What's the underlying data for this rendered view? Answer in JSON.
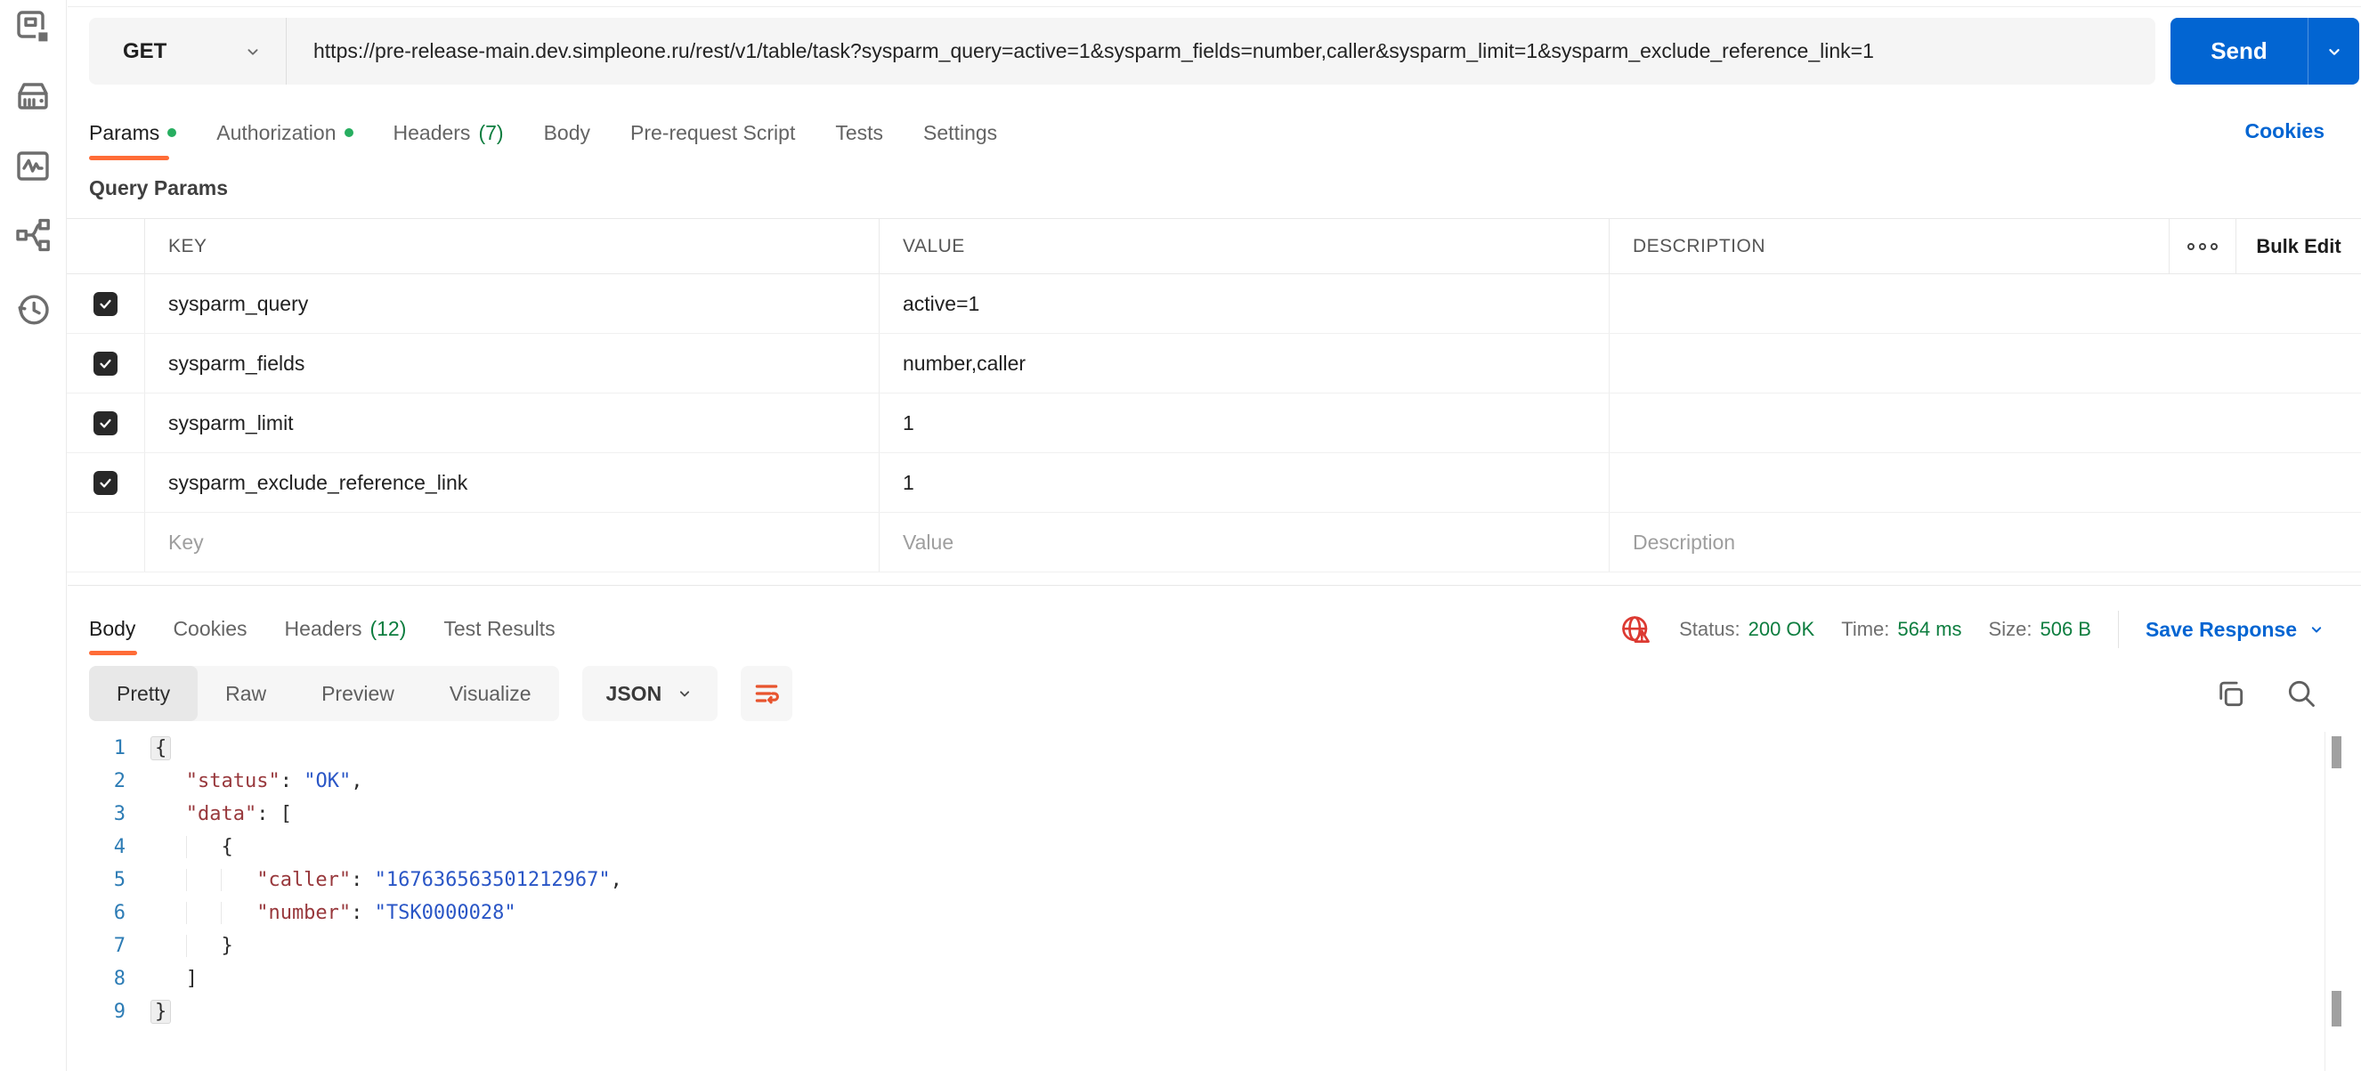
{
  "sidebar": {
    "icons": [
      "collections",
      "environments",
      "monitors",
      "flows",
      "history"
    ]
  },
  "request": {
    "method": "GET",
    "url": "https://pre-release-main.dev.simpleone.ru/rest/v1/table/task?sysparm_query=active=1&sysparm_fields=number,caller&sysparm_limit=1&sysparm_exclude_reference_link=1",
    "send_label": "Send",
    "cookies_link": "Cookies",
    "tabs": [
      {
        "label": "Params",
        "modified": true,
        "active": true
      },
      {
        "label": "Authorization",
        "modified": true
      },
      {
        "label": "Headers",
        "count": "(7)"
      },
      {
        "label": "Body"
      },
      {
        "label": "Pre-request Script"
      },
      {
        "label": "Tests"
      },
      {
        "label": "Settings"
      }
    ]
  },
  "query_params": {
    "title": "Query Params",
    "columns": {
      "key": "KEY",
      "value": "VALUE",
      "description": "DESCRIPTION"
    },
    "bulk_edit_label": "Bulk Edit",
    "more_options_icon": "three-dots",
    "rows": [
      {
        "checked": true,
        "key": "sysparm_query",
        "value": "active=1",
        "description": ""
      },
      {
        "checked": true,
        "key": "sysparm_fields",
        "value": "number,caller",
        "description": ""
      },
      {
        "checked": true,
        "key": "sysparm_limit",
        "value": "1",
        "description": ""
      },
      {
        "checked": true,
        "key": "sysparm_exclude_reference_link",
        "value": "1",
        "description": ""
      }
    ],
    "placeholder_row": {
      "key": "Key",
      "value": "Value",
      "description": "Description"
    }
  },
  "response": {
    "tabs": [
      {
        "label": "Body",
        "active": true
      },
      {
        "label": "Cookies"
      },
      {
        "label": "Headers",
        "count": "(12)"
      },
      {
        "label": "Test Results"
      }
    ],
    "meta": {
      "network_icon": "globe-warning",
      "status_label": "Status:",
      "status_value": "200 OK",
      "time_label": "Time:",
      "time_value": "564 ms",
      "size_label": "Size:",
      "size_value": "506 B",
      "save_label": "Save Response"
    },
    "viewer": {
      "tabs": [
        {
          "label": "Pretty",
          "active": true
        },
        {
          "label": "Raw"
        },
        {
          "label": "Preview"
        },
        {
          "label": "Visualize"
        }
      ],
      "language": "JSON",
      "icons": [
        "wrap-text",
        "copy",
        "search"
      ]
    },
    "code": {
      "lines": [
        {
          "n": "1",
          "tokens": [
            {
              "t": "fold",
              "v": "{"
            }
          ]
        },
        {
          "n": "2",
          "tokens": [
            {
              "t": "key",
              "v": "\"status\""
            },
            {
              "t": "p",
              "v": ": "
            },
            {
              "t": "str",
              "v": "\"OK\""
            },
            {
              "t": "p",
              "v": ","
            }
          ]
        },
        {
          "n": "3",
          "tokens": [
            {
              "t": "key",
              "v": "\"data\""
            },
            {
              "t": "p",
              "v": ": ["
            }
          ]
        },
        {
          "n": "4",
          "tokens": [
            {
              "t": "p",
              "v": "{"
            }
          ]
        },
        {
          "n": "5",
          "tokens": [
            {
              "t": "key",
              "v": "\"caller\""
            },
            {
              "t": "p",
              "v": ": "
            },
            {
              "t": "str",
              "v": "\"167636563501212967\""
            },
            {
              "t": "p",
              "v": ","
            }
          ]
        },
        {
          "n": "6",
          "tokens": [
            {
              "t": "key",
              "v": "\"number\""
            },
            {
              "t": "p",
              "v": ": "
            },
            {
              "t": "str",
              "v": "\"TSK0000028\""
            }
          ]
        },
        {
          "n": "7",
          "tokens": [
            {
              "t": "p",
              "v": "}"
            }
          ]
        },
        {
          "n": "8",
          "tokens": [
            {
              "t": "p",
              "v": "]"
            }
          ]
        },
        {
          "n": "9",
          "tokens": [
            {
              "t": "fold",
              "v": "}"
            }
          ]
        }
      ]
    }
  },
  "colors": {
    "accent_orange": "#ff6c37",
    "link_blue": "#0265d2",
    "send_button_blue": "#0265d2",
    "status_green": "#0d7d3f",
    "modified_dot_green": "#27ae60",
    "network_error_red": "#dc3a32",
    "code_key": "#98383c",
    "code_string": "#2a56c6",
    "code_line_number": "#2d7cb5"
  }
}
